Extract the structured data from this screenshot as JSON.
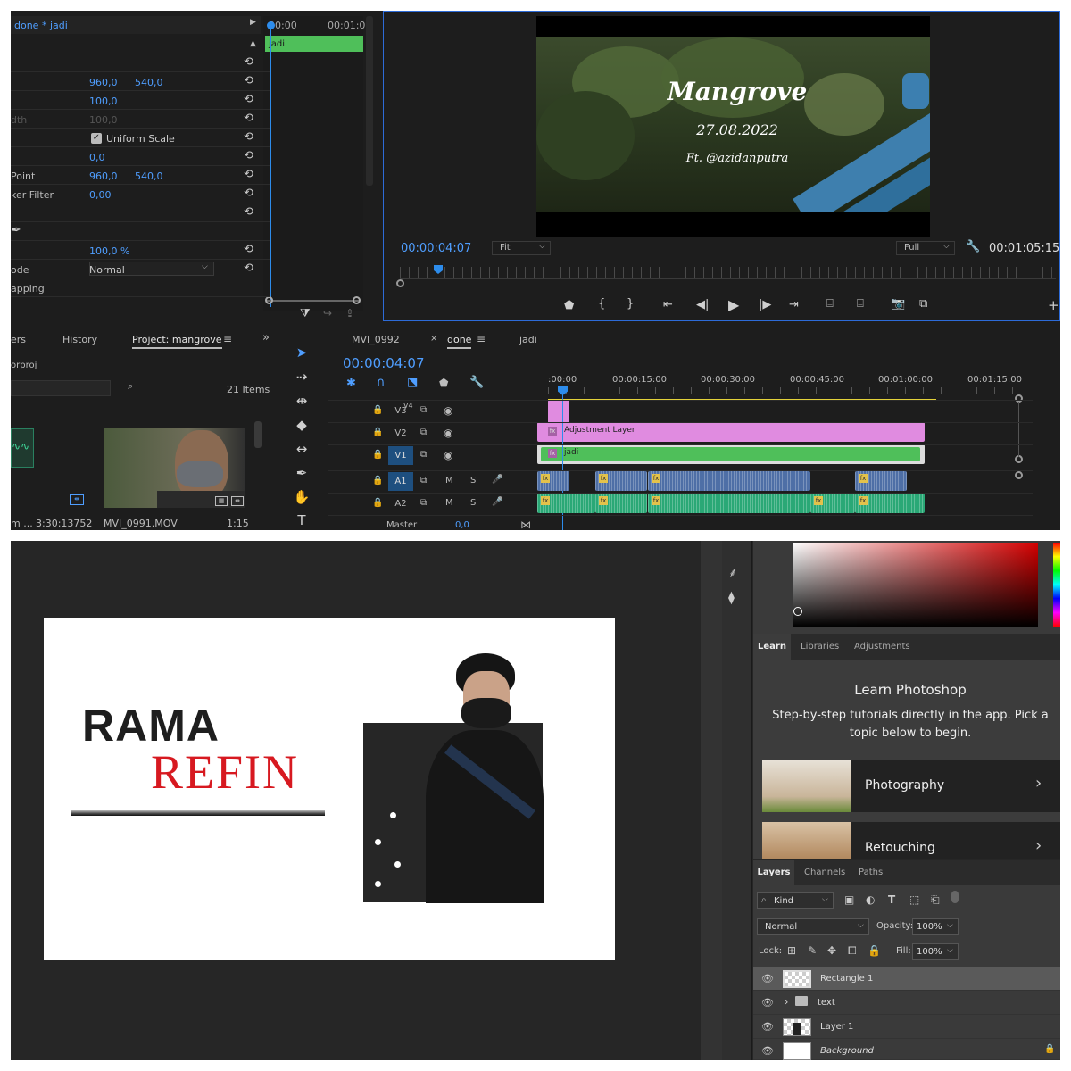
{
  "premiere": {
    "effect_controls": {
      "seq_tab": "done * jadi",
      "clip_label": "jadi",
      "tc_start": "00:00",
      "tc_end": "00:01:0",
      "rows": [
        {
          "label": "",
          "v1": "",
          "v2": ""
        },
        {
          "label": "",
          "v1": "960,0",
          "v2": "540,0"
        },
        {
          "label": "",
          "v1": "100,0",
          "v2": ""
        },
        {
          "label": "dth",
          "v1": "100,0",
          "v2": ""
        },
        {
          "label": "",
          "v1": "Uniform Scale",
          "v2": ""
        },
        {
          "label": "",
          "v1": "0,0",
          "v2": ""
        },
        {
          "label": "Point",
          "v1": "960,0",
          "v2": "540,0"
        },
        {
          "label": "ker Filter",
          "v1": "0,00",
          "v2": ""
        },
        {
          "label": "",
          "v1": "",
          "v2": ""
        },
        {
          "label": "",
          "v1": "",
          "v2": ""
        },
        {
          "label": "",
          "v1": "100,0 %",
          "v2": ""
        },
        {
          "label": "ode",
          "v1": "Normal",
          "v2": ""
        },
        {
          "label": "apping",
          "v1": "",
          "v2": ""
        }
      ]
    },
    "program": {
      "title": "Mangrove",
      "date": "27.08.2022",
      "credit": "Ft. @azidanputra",
      "timecode": "00:00:04:07",
      "fit": "Fit",
      "quality": "Full",
      "duration": "00:01:05:15"
    },
    "project": {
      "tabs": [
        "ers",
        "History",
        "Project: mangrove"
      ],
      "file": "orproj",
      "items_count": "21 Items",
      "item1_name": "m ...",
      "item1_dur": "3:30:13752",
      "item2_name": "MVI_0991.MOV",
      "item2_dur": "1:15"
    },
    "timeline": {
      "tabs": [
        "MVI_0992",
        "done",
        "jadi"
      ],
      "timecode": "00:00:04:07",
      "ruler": [
        ":00:00",
        "00:00:15:00",
        "00:00:30:00",
        "00:00:45:00",
        "00:01:00:00",
        "00:01:15:00"
      ],
      "tracks": [
        "V3",
        "V2",
        "V1",
        "A1",
        "A2"
      ],
      "v4_label": "V4",
      "master_label": "Master",
      "master_val": "0,0",
      "mute": "M",
      "solo": "S",
      "adjustment_label": "Adjustment Layer",
      "jadi_label": "jadi",
      "fx": "fx"
    }
  },
  "photoshop": {
    "canvas": {
      "line1": "RAMA",
      "line2": "REFIN"
    },
    "panel_tabs": [
      "Learn",
      "Libraries",
      "Adjustments"
    ],
    "learn_title": "Learn Photoshop",
    "learn_desc": "Step-by-step tutorials directly in the app. Pick a topic below to begin.",
    "tutorials": [
      "Photography",
      "Retouching"
    ],
    "layer_tabs": [
      "Layers",
      "Channels",
      "Paths"
    ],
    "kind": "Kind",
    "blend": "Normal",
    "opacity_label": "Opacity:",
    "opacity": "100%",
    "lock_label": "Lock:",
    "fill_label": "Fill:",
    "fill": "100%",
    "layers": [
      "Rectangle 1",
      "text",
      "Layer 1",
      "Background"
    ]
  },
  "colors": {
    "accent": "#2d8ceb",
    "green_clip": "#4fbf5a",
    "pink_clip": "#e08be0",
    "audio_a1": "#4e6fa6",
    "audio_a2": "#2aa876",
    "refin_red": "#d71920"
  }
}
